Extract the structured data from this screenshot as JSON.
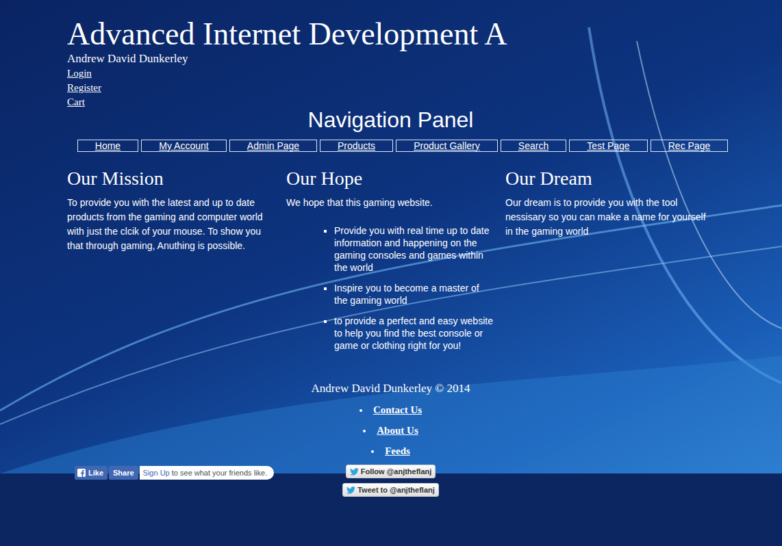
{
  "site": {
    "title": "Advanced Internet Development A",
    "author": "Andrew David Dunkerley"
  },
  "account_links": [
    "Login",
    "Register",
    "Cart"
  ],
  "nav": {
    "title": "Navigation Panel",
    "items": [
      "Home",
      "My Account",
      "Admin Page",
      "Products",
      "Product Gallery",
      "Search",
      "Test Page",
      "Rec Page"
    ]
  },
  "sections": [
    {
      "heading": "Our Mission",
      "text": "To provide you with the latest and up to date products from the gaming and computer world with just the clcik of your mouse. To show you that through gaming, Anuthing is possible.",
      "bullets": []
    },
    {
      "heading": "Our Hope",
      "text": "We hope that this gaming website.",
      "bullets": [
        "Provide you with real time up to date information and happening on the gaming consoles and games within the world",
        "Inspire you to become a master of the gaming world",
        "to provide a perfect and easy website to help you find the best console or game or clothing right for you!"
      ]
    },
    {
      "heading": "Our Dream",
      "text": "Our dream is to provide you with the tool nessisary so you can make a name for yourself in the gaming world",
      "bullets": []
    }
  ],
  "footer": {
    "copyright": "Andrew David Dunkerley © 2014",
    "links": [
      "Contact Us",
      "About Us",
      "Feeds"
    ]
  },
  "social": {
    "facebook": {
      "like": "Like",
      "share": "Share",
      "signup": "Sign Up",
      "prompt": "to see what your friends like."
    },
    "twitter": [
      "Follow @anjtheflanj",
      "Tweet to @anjtheflanj"
    ]
  }
}
